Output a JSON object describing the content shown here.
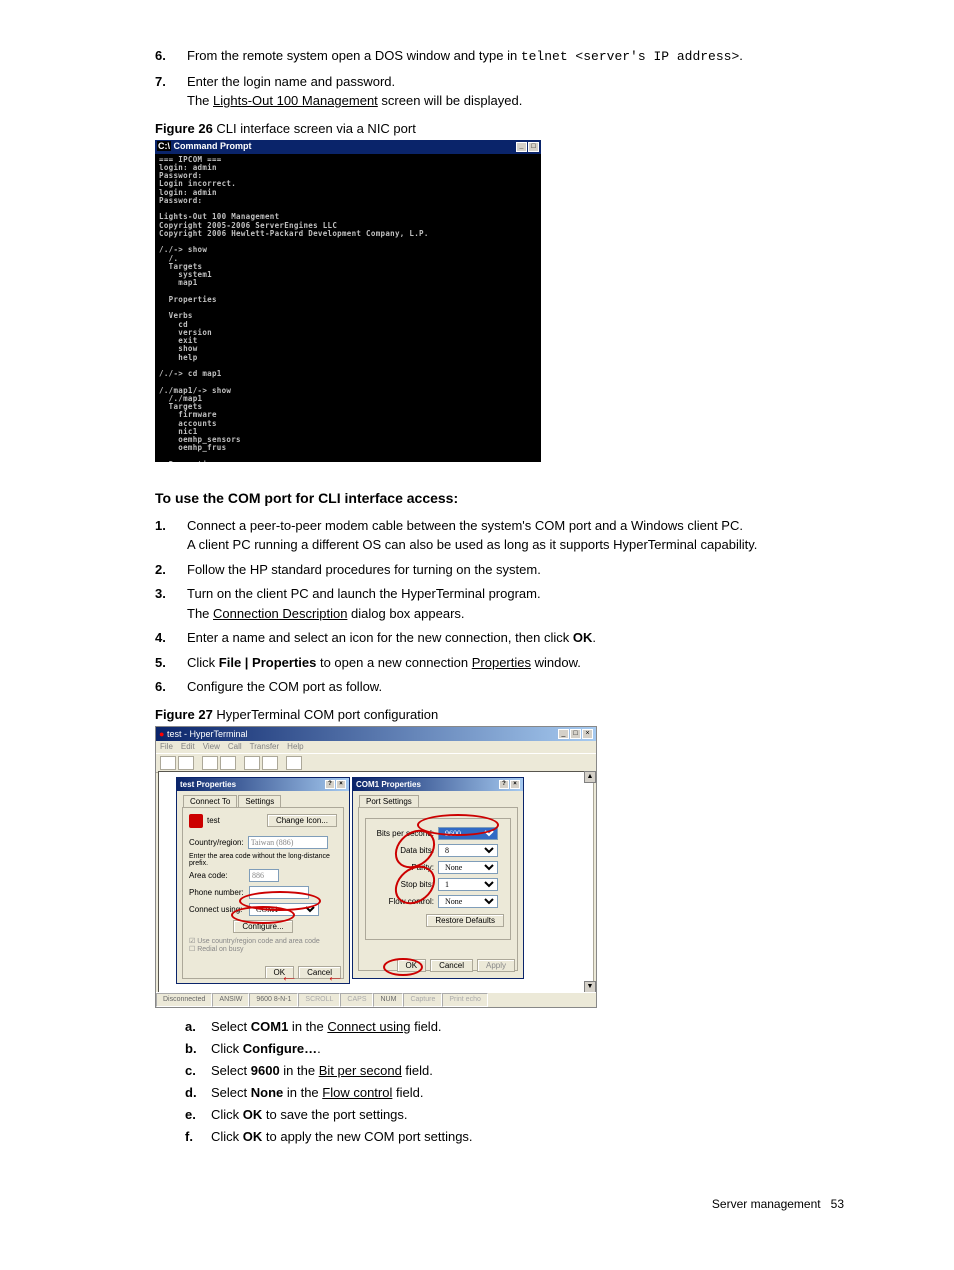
{
  "list1": {
    "items": [
      {
        "num": "6.",
        "pre": "From the remote system open a DOS window and type in ",
        "mono": "telnet <server's IP address>",
        "post": "."
      },
      {
        "num": "7.",
        "l1": "Enter the login name and password.",
        "l2a": "The ",
        "l2u": "Lights-Out 100 Management",
        "l2b": " screen will be displayed."
      }
    ]
  },
  "fig26": {
    "caption_b": "Figure 26",
    "caption_r": " CLI interface screen via a NIC port",
    "title_prefix": "C:\\",
    "title": "Command Prompt",
    "win_btns": [
      "_",
      "□"
    ],
    "console": "=== IPCOM ===\nlogin: admin\nPassword:\nLogin incorrect.\nlogin: admin\nPassword:\n\nLights-Out 100 Management\nCopyright 2005-2006 ServerEngines LLC\nCopyright 2006 Hewlett-Packard Development Company, L.P.\n\n/./-> show\n  /.\n  Targets\n    system1\n    map1\n\n  Properties\n\n  Verbs\n    cd\n    version\n    exit\n    show\n    help\n\n/./-> cd map1\n\n/./map1/-> show\n  /./map1\n  Targets\n    firmware\n    accounts\n    nic1\n    oemhp_sensors\n    oemhp_frus\n\n  Properties\n    name=Hewlett-Packard\n\n  Verbs\n    cd\n    version\n    exit\n    show"
  },
  "section_h": "To use the COM port for CLI interface access:",
  "list2": {
    "items": [
      {
        "num": "1.",
        "l1": "Connect a peer-to-peer modem cable between the system's COM port and a Windows client PC.",
        "l2": "A client PC running a different OS can also be used as long as it supports HyperTerminal capability."
      },
      {
        "num": "2.",
        "l1": "Follow the HP standard procedures for turning on the system."
      },
      {
        "num": "3.",
        "l1": "Turn on the client PC and launch the HyperTerminal program.",
        "l2a": "The ",
        "l2u": "Connection Description",
        "l2b": " dialog box appears."
      },
      {
        "num": "4.",
        "l1a": "Enter a name and select an icon for the new connection, then click ",
        "l1b": "OK",
        "l1c": "."
      },
      {
        "num": "5.",
        "l1a": "Click ",
        "l1b": "File | Properties",
        "l1c": " to open a new connection ",
        "l1u": "Properties",
        "l1d": " window."
      },
      {
        "num": "6.",
        "l1": "Configure the COM port as follow."
      }
    ]
  },
  "fig27": {
    "caption_b": "Figure 27",
    "caption_r": " HyperTerminal COM port configuration",
    "main_title": "test - HyperTerminal",
    "win_btns": [
      "_",
      "□",
      "×"
    ],
    "menu": [
      "File",
      "Edit",
      "View",
      "Call",
      "Transfer",
      "Help"
    ],
    "status": [
      "Disconnected",
      "ANSIW",
      "9600 8-N-1",
      "SCROLL",
      "CAPS",
      "NUM",
      "Capture",
      "Print echo"
    ],
    "dlg1": {
      "title": "test Properties",
      "btns": [
        "?",
        "×"
      ],
      "tabs": [
        "Connect To",
        "Settings"
      ],
      "icon_label": "test",
      "change_icon": "Change Icon...",
      "country": "Country/region:",
      "country_val": "Taiwan (886)",
      "area_note": "Enter the area code without the long-distance prefix.",
      "area": "Area code:",
      "area_val": "886",
      "phone": "Phone number:",
      "connect": "Connect using:",
      "connect_val": "COM1",
      "configure": "Configure...",
      "chk1": "Use country/region code and area code",
      "chk2": "Redial on busy",
      "ok": "OK",
      "cancel": "Cancel"
    },
    "dlg2": {
      "title": "COM1 Properties",
      "btns": [
        "?",
        "×"
      ],
      "tab": "Port Settings",
      "bps": "Bits per second:",
      "bps_val": "9600",
      "databits": "Data bits:",
      "databits_val": "8",
      "parity": "Parity:",
      "parity_val": "None",
      "stopbits": "Stop bits:",
      "stopbits_val": "1",
      "flow": "Flow control:",
      "flow_val": "None",
      "restore": "Restore Defaults",
      "ok": "OK",
      "cancel": "Cancel",
      "apply": "Apply"
    }
  },
  "sublist": {
    "items": [
      {
        "m": "a.",
        "a": "Select ",
        "b": "COM1",
        "c": " in the ",
        "u": "Connect using",
        "d": " field."
      },
      {
        "m": "b.",
        "a": "Click ",
        "b": "Configure…",
        "c": "."
      },
      {
        "m": "c.",
        "a": "Select ",
        "b": "9600",
        "c": " in the ",
        "u": "Bit per second",
        "d": " field."
      },
      {
        "m": "d.",
        "a": "Select ",
        "b": "None",
        "c": " in the ",
        "u": "Flow control",
        "d": " field."
      },
      {
        "m": "e.",
        "a": "Click ",
        "b": "OK",
        "c": " to save the port settings."
      },
      {
        "m": "f.",
        "a": "Click ",
        "b": "OK",
        "c": " to apply the new COM port settings."
      }
    ]
  },
  "footer": {
    "label": "Server management",
    "page": "53"
  }
}
